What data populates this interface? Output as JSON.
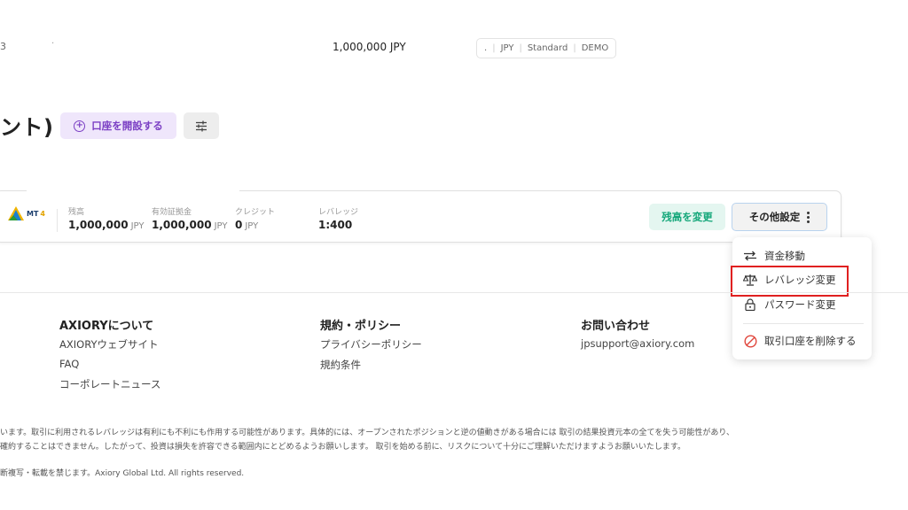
{
  "top_bar": {
    "fragment": "3",
    "dot": "·",
    "balance": "1,000,000 JPY",
    "pill_lead": ".",
    "pill_items": [
      "JPY",
      "Standard",
      "DEMO"
    ]
  },
  "header": {
    "title_fragment": "ント)",
    "open_account_label": "口座を開設する",
    "plus_symbol": "+"
  },
  "account_card": {
    "platform": {
      "text": "MT",
      "version": "4"
    },
    "stats": [
      {
        "label": "残高",
        "value": "1,000,000",
        "unit": "JPY"
      },
      {
        "label": "有効証拠金",
        "value": "1,000,000",
        "unit": "JPY"
      },
      {
        "label": "クレジット",
        "value": "0",
        "unit": "JPY"
      },
      {
        "label": "レバレッジ",
        "value": "1:400",
        "unit": ""
      }
    ],
    "change_balance_label": "残高を変更",
    "other_settings_label": "その他設定"
  },
  "dropdown": {
    "items": [
      {
        "label": "資金移動",
        "icon": "transfer-arrows-icon"
      },
      {
        "label": "レバレッジ変更",
        "icon": "scale-icon"
      },
      {
        "label": "パスワード変更",
        "icon": "lock-icon"
      },
      {
        "label": "取引口座を削除する",
        "icon": "prohibited-icon"
      }
    ]
  },
  "footer": {
    "columns": [
      {
        "title": "AXIORYについて",
        "links": [
          "AXIORYウェブサイト",
          "FAQ",
          "コーポレートニュース"
        ]
      },
      {
        "title": "規約・ポリシー",
        "links": [
          "プライバシーポリシー",
          "規約条件"
        ]
      },
      {
        "title": "お問い合わせ",
        "links": [
          "jpsupport@axiory.com"
        ]
      }
    ],
    "disclaimer_lines": [
      "います。取引に利用されるレバレッジは有利にも不利にも作用する可能性があります。具体的には、オープンされたポジションと逆の値動きがある場合には 取引の結果投資元本の全てを失う可能性があり、",
      "確約することはできません。したがって、投資は損失を許容できる範囲内にとどめるようお願いします。 取引を始める前に、リスクについて十分にご理解いただけますようお願いいたします。"
    ],
    "copyright": "断複写・転載を禁じます。Axiory Global Ltd. All rights reserved."
  },
  "colors": {
    "accent_purple": "#7b3fc4",
    "accent_green": "#15a77a",
    "highlight_red": "#e02020"
  }
}
